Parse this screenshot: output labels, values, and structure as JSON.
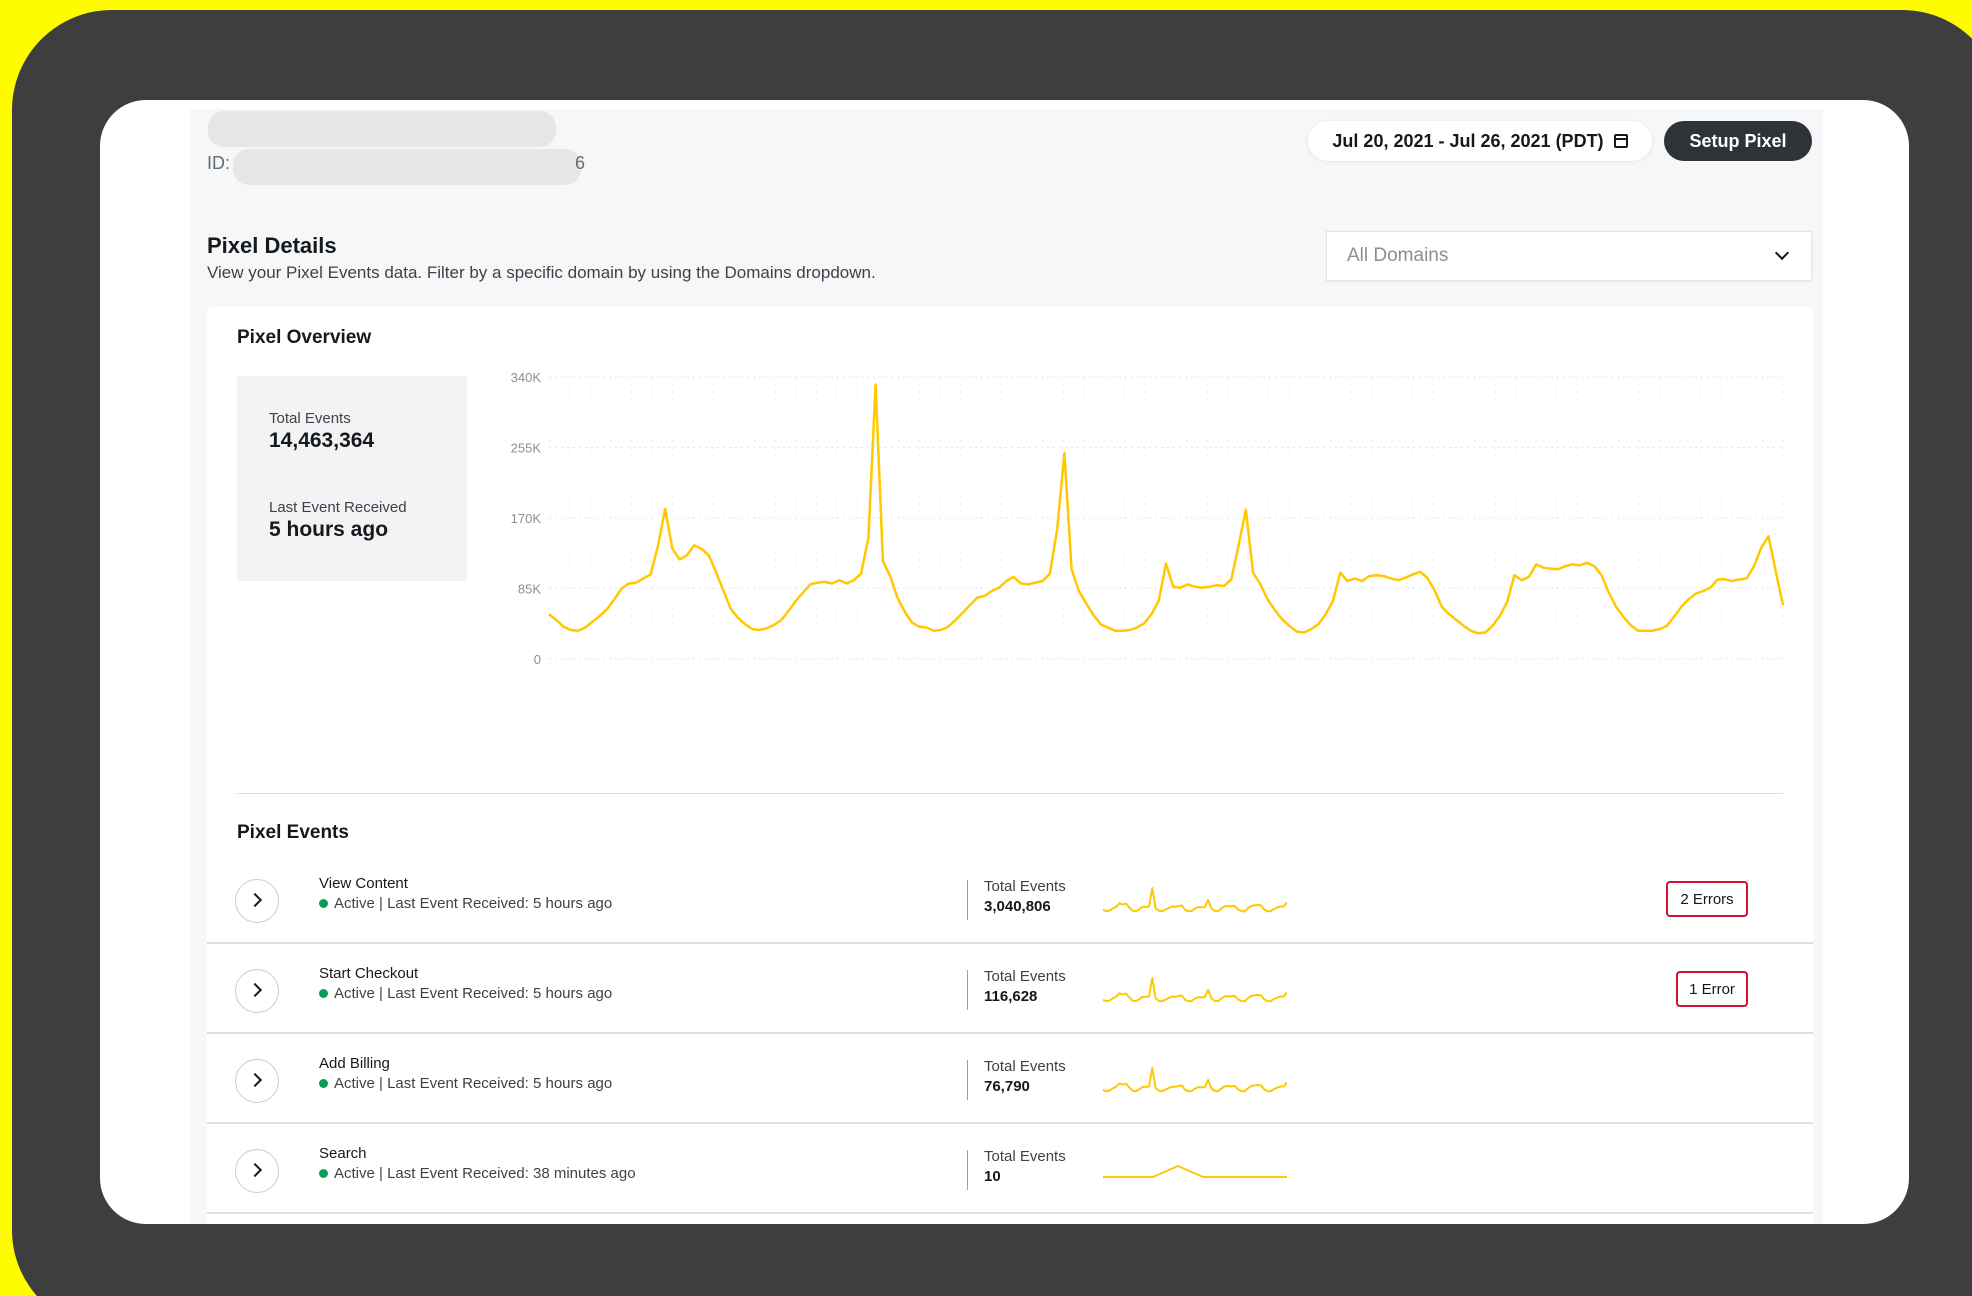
{
  "header": {
    "id_label": "ID:",
    "id_suffix": "6",
    "date_range": "Jul 20, 2021 - Jul 26, 2021 (PDT)",
    "setup_button": "Setup Pixel"
  },
  "details": {
    "title": "Pixel Details",
    "subtitle": "View your Pixel Events data. Filter by a specific domain by using the Domains dropdown.",
    "domain_select": "All Domains"
  },
  "overview": {
    "title": "Pixel Overview",
    "total_events_label": "Total Events",
    "total_events_value": "14,463,364",
    "last_event_label": "Last Event Received",
    "last_event_value": "5 hours ago"
  },
  "colors": {
    "accent": "#FFC800",
    "status_active": "#0d9b5c",
    "error": "#d0103a"
  },
  "chart_data": {
    "type": "line",
    "ylim": [
      0,
      340000
    ],
    "y_ticks": [
      "0",
      "85K",
      "170K",
      "255K",
      "340K"
    ],
    "grid": true,
    "series": [
      {
        "values": [
          54000,
          47000,
          39000,
          35000,
          34000,
          38000,
          45000,
          52000,
          60000,
          72000,
          85000,
          91000,
          92000,
          97000,
          102000,
          136000,
          181000,
          133000,
          120000,
          125000,
          137000,
          133000,
          125000,
          105000,
          83000,
          61000,
          50000,
          42000,
          36000,
          35000,
          37000,
          41000,
          47000,
          58000,
          70000,
          80000,
          90000,
          92000,
          93000,
          91000,
          95000,
          91000,
          95000,
          103000,
          146000,
          331000,
          118000,
          100000,
          74000,
          57000,
          44000,
          39000,
          38000,
          34000,
          35000,
          39000,
          47000,
          56000,
          65000,
          74000,
          76000,
          82000,
          86000,
          94000,
          99000,
          91000,
          90000,
          92000,
          94000,
          103000,
          156000,
          248000,
          108000,
          82000,
          67000,
          53000,
          42000,
          38000,
          34000,
          34000,
          35000,
          38000,
          43000,
          54000,
          70000,
          115000,
          87000,
          86000,
          90000,
          87000,
          86000,
          87000,
          89000,
          88000,
          96000,
          137000,
          180000,
          104000,
          90000,
          72000,
          59000,
          48000,
          40000,
          33000,
          32000,
          36000,
          42000,
          54000,
          70000,
          104000,
          94000,
          97000,
          94000,
          100000,
          101000,
          100000,
          97000,
          95000,
          98000,
          102000,
          105000,
          98000,
          83000,
          63000,
          54000,
          47000,
          40000,
          34000,
          31000,
          32000,
          40000,
          52000,
          69000,
          101000,
          95000,
          99000,
          114000,
          110000,
          109000,
          108000,
          112000,
          114000,
          113000,
          116000,
          112000,
          101000,
          80000,
          63000,
          51000,
          41000,
          34000,
          34000,
          34000,
          36000,
          40000,
          51000,
          63000,
          72000,
          79000,
          82000,
          86000,
          96000,
          96000,
          94000,
          96000,
          97000,
          112000,
          134000,
          148000,
          106000,
          65000
        ]
      }
    ]
  },
  "events": {
    "title": "Pixel Events",
    "rows": [
      {
        "name": "View Content",
        "status": "Active | Last Event Received: 5 hours ago",
        "total_label": "Total Events",
        "total": "3,040,806",
        "errors": "2 Errors",
        "spark": "noisy"
      },
      {
        "name": "Start Checkout",
        "status": "Active | Last Event Received: 5 hours ago",
        "total_label": "Total Events",
        "total": "116,628",
        "errors": "1 Error",
        "spark": "noisy"
      },
      {
        "name": "Add Billing",
        "status": "Active | Last Event Received: 5 hours ago",
        "total_label": "Total Events",
        "total": "76,790",
        "errors": "",
        "spark": "noisy"
      },
      {
        "name": "Search",
        "status": "Active | Last Event Received: 38 minutes ago",
        "total_label": "Total Events",
        "total": "10",
        "errors": "",
        "spark": "bump"
      }
    ]
  }
}
